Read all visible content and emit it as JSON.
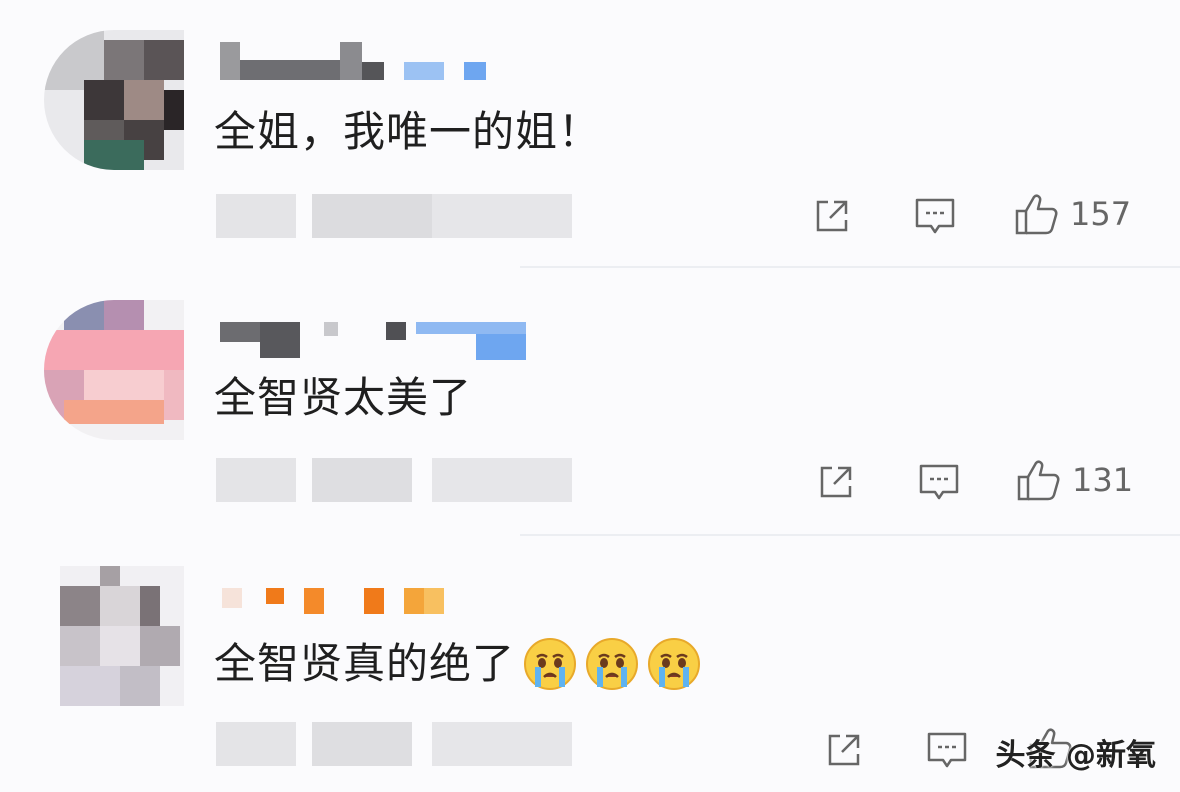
{
  "comments": [
    {
      "text": "全姐，我唯一的姐！",
      "likes": "157"
    },
    {
      "text": "全智贤太美了",
      "likes": "131"
    },
    {
      "text": "全智贤真的绝了",
      "likes": ""
    }
  ],
  "watermark": "头条 @新氧",
  "colors": {
    "accent_blue": "#6ea6f0",
    "orange": "#f07a1a",
    "icon_gray": "#666666",
    "divider": "#eceef2"
  },
  "icons": [
    "share-icon",
    "comment-icon",
    "like-icon",
    "crying-emoji-icon"
  ]
}
